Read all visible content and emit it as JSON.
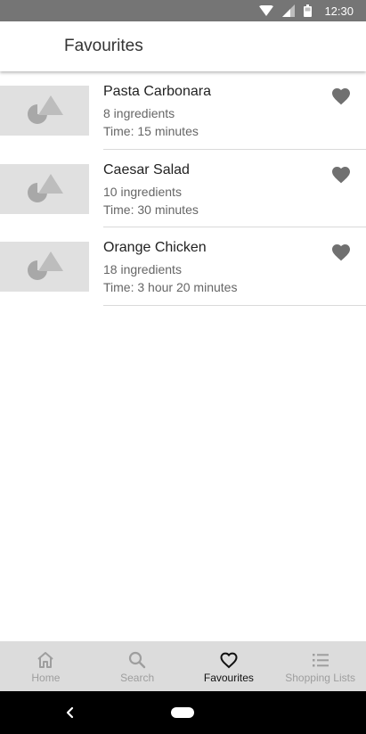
{
  "status_bar": {
    "time": "12:30"
  },
  "app_bar": {
    "title": "Favourites"
  },
  "recipes": [
    {
      "name": "Pasta Carbonara",
      "ingredients": "8 ingredients",
      "time": "Time: 15 minutes"
    },
    {
      "name": "Caesar Salad",
      "ingredients": "10 ingredients",
      "time": "Time: 30 minutes"
    },
    {
      "name": "Orange Chicken",
      "ingredients": "18 ingredients",
      "time": "Time: 3 hour 20 minutes"
    }
  ],
  "bottom_nav": {
    "items": [
      {
        "label": "Home",
        "icon": "home-icon"
      },
      {
        "label": "Search",
        "icon": "search-icon"
      },
      {
        "label": "Favourites",
        "icon": "heart-icon",
        "active": true
      },
      {
        "label": "Shopping Lists",
        "icon": "list-icon"
      }
    ]
  },
  "colors": {
    "status_bar": "#757575",
    "nav_background": "#dcdcdc",
    "heart": "#707070",
    "thumbnail": "#e0e0e0"
  }
}
